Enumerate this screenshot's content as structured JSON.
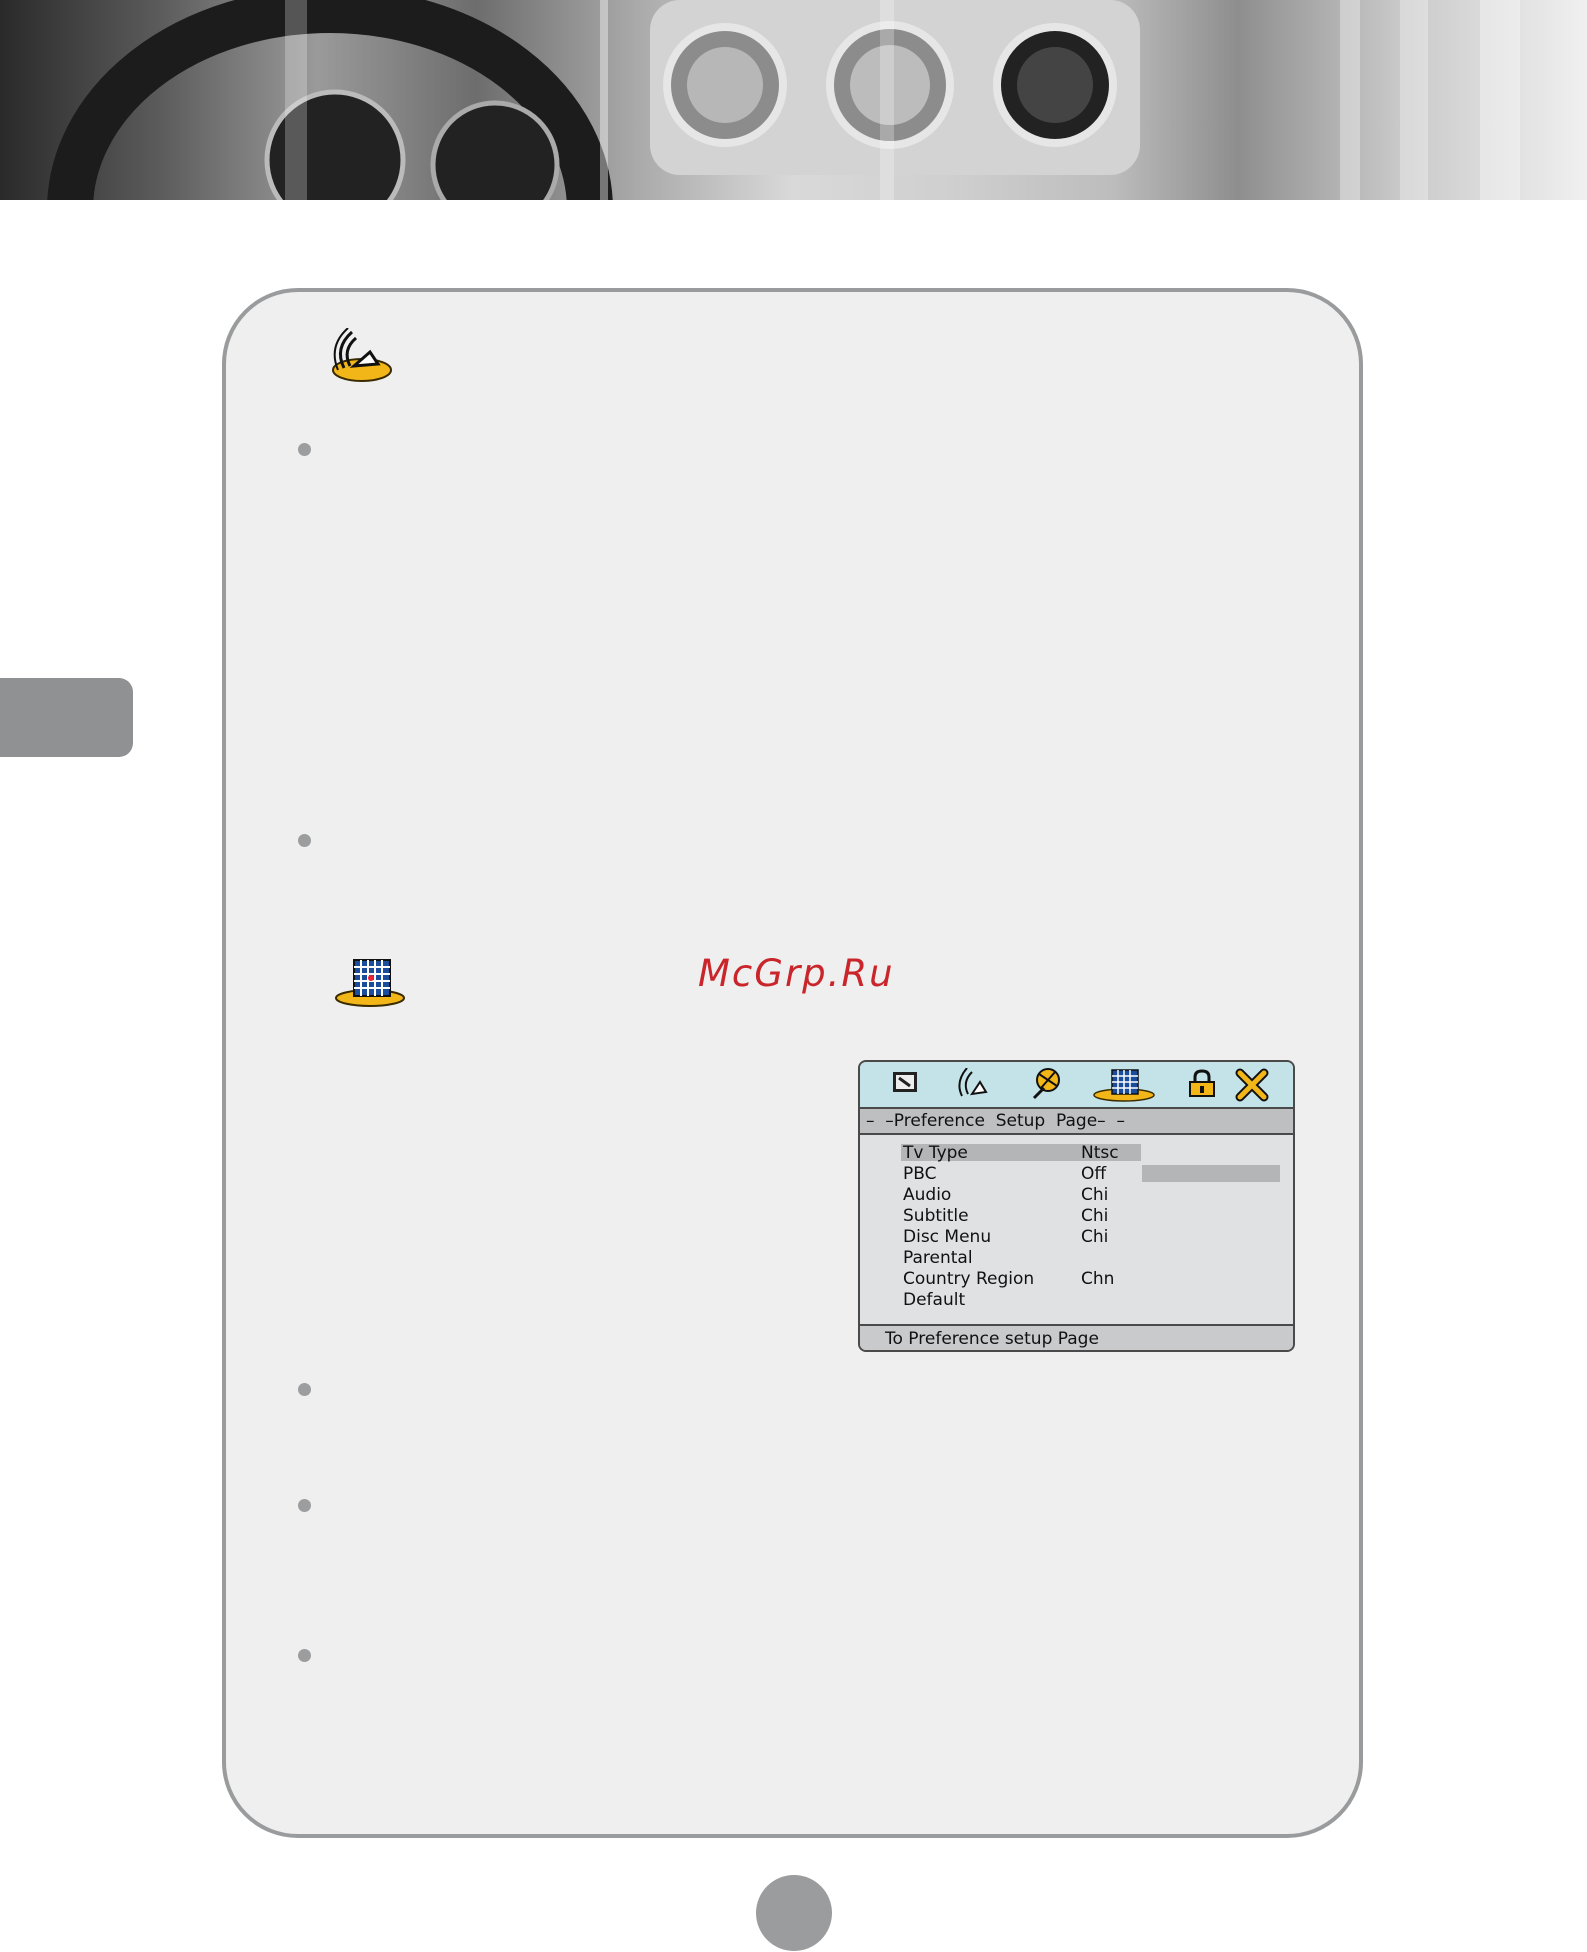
{
  "watermark": "McGrp.Ru",
  "osd_menu": {
    "title": "–  –Preference  Setup  Page–  –",
    "items": [
      {
        "label": "Tv Type",
        "value": "Ntsc"
      },
      {
        "label": "PBC",
        "value": "Off"
      },
      {
        "label": "Audio",
        "value": "Chi"
      },
      {
        "label": "Subtitle",
        "value": "Chi"
      },
      {
        "label": "Disc Menu",
        "value": "Chi"
      },
      {
        "label": "Parental",
        "value": ""
      },
      {
        "label": "Country Region",
        "value": "Chn"
      },
      {
        "label": "Default",
        "value": ""
      }
    ],
    "status": "To  Preference  setup  Page",
    "tab_icons": [
      "general-setup-icon",
      "audio-setup-icon",
      "video-setup-icon",
      "preference-setup-icon",
      "password-lock-icon",
      "exit-icon"
    ]
  },
  "section_icons": [
    "audio-setup-icon",
    "preference-setup-icon"
  ],
  "colors": {
    "panel_bg": "#eeefee",
    "panel_border": "#999b9d",
    "accent_yellow": "#f3b618",
    "watermark_red": "#c9252b",
    "osd_iconbar": "#c4e3e8"
  }
}
